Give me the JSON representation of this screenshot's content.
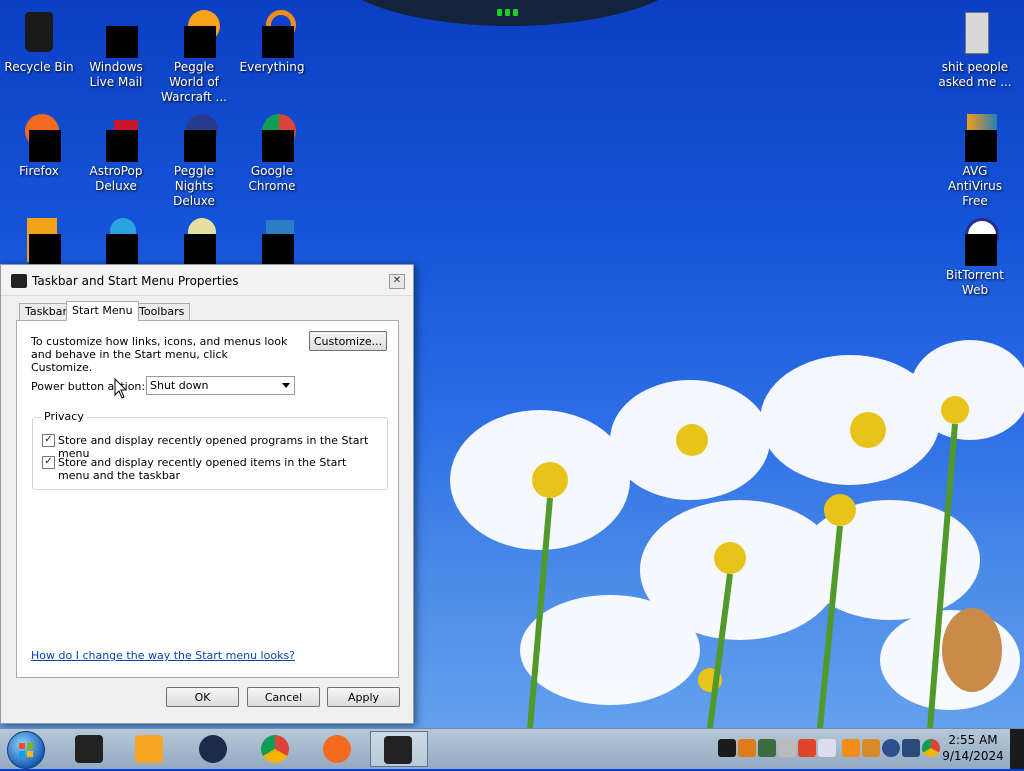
{
  "desktop": {
    "icons": [
      {
        "label": "Recycle Bin"
      },
      {
        "label": "Windows Live Mail"
      },
      {
        "label": "Peggle World of Warcraft ..."
      },
      {
        "label": "Everything"
      },
      {
        "label": "shit people asked me ..."
      },
      {
        "label": "Firefox"
      },
      {
        "label": "AstroPop Deluxe"
      },
      {
        "label": "Peggle Nights Deluxe"
      },
      {
        "label": "Google Chrome"
      },
      {
        "label": "AVG AntiVirus Free"
      },
      {
        "label": "BitTorrent Web"
      }
    ]
  },
  "dialog": {
    "title": "Taskbar and Start Menu Properties",
    "close_label": "✕",
    "tabs": [
      {
        "label": "Taskbar",
        "active": false
      },
      {
        "label": "Start Menu",
        "active": true
      },
      {
        "label": "Toolbars",
        "active": false
      }
    ],
    "intro_text": "To customize how links, icons, and menus look and behave in the Start menu, click Customize.",
    "customize_label": "Customize...",
    "power_label": "Power button action:",
    "power_value": "Shut down",
    "privacy_legend": "Privacy",
    "checkboxes": [
      {
        "label": "Store and display recently opened programs in the Start menu",
        "checked": true
      },
      {
        "label": "Store and display recently opened items in the Start menu and the taskbar",
        "checked": true
      }
    ],
    "help_link": "How do I change the way the Start menu looks?",
    "ok_label": "OK",
    "cancel_label": "Cancel",
    "apply_label": "Apply"
  },
  "taskbar": {
    "clock_time": "2:55 AM",
    "clock_date": "9/14/2024"
  },
  "colors": {
    "accent_blue": "#1554d8",
    "link": "#0645ad"
  }
}
